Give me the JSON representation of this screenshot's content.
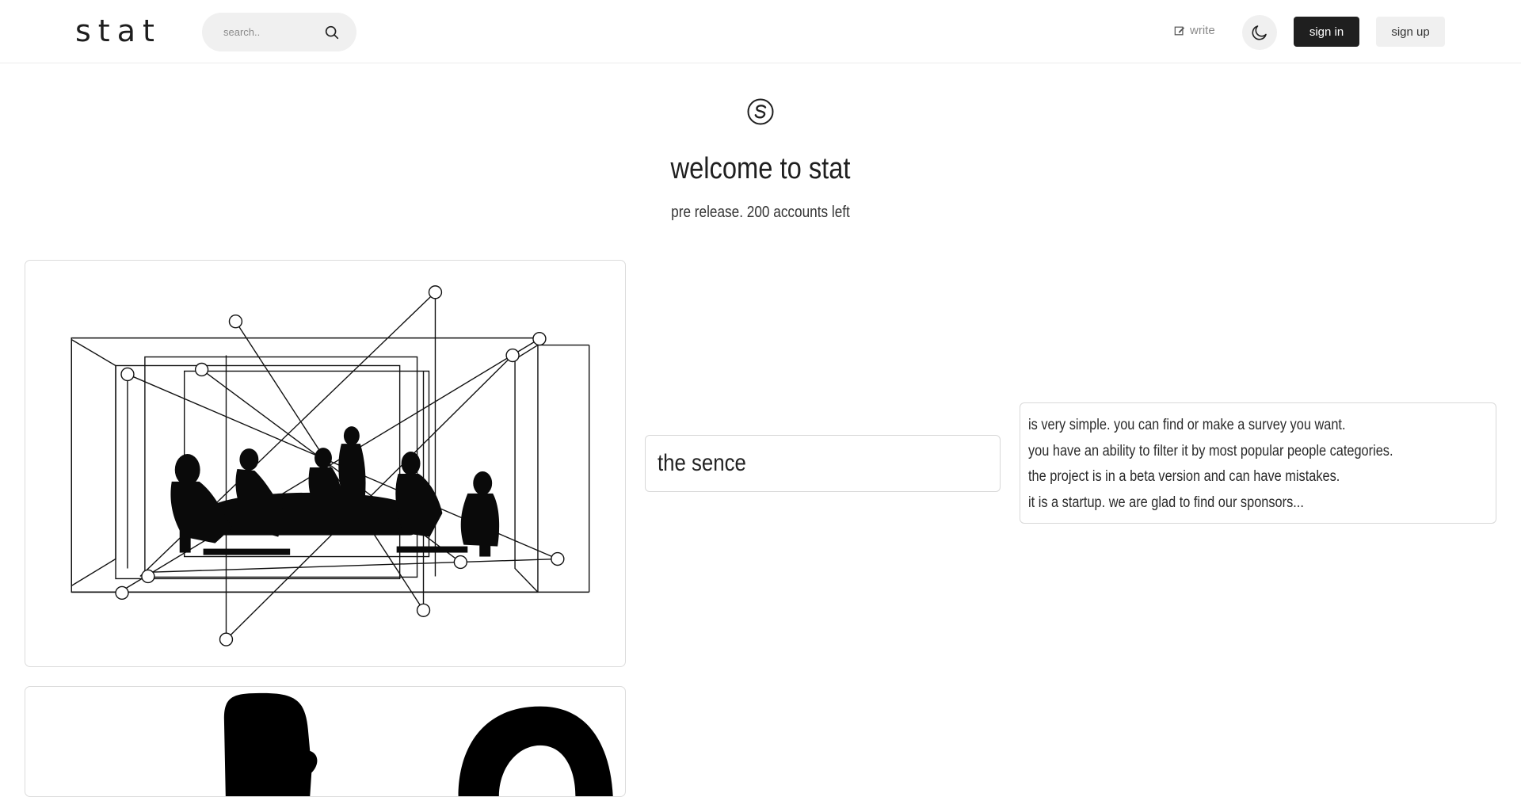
{
  "header": {
    "logo": "stat",
    "search": {
      "placeholder": "search..",
      "value": ""
    },
    "write_label": "write",
    "theme_toggle_icon": "moon-icon",
    "signin_label": "sign in",
    "signup_label": "sign up"
  },
  "hero": {
    "icon": "stat-s-logo-icon",
    "title": "welcome to stat",
    "subtitle": "pre release. 200 accounts left"
  },
  "sections": {
    "sence_title": "the sence",
    "description_lines": [
      "is very simple. you can find or make a survey you want.",
      "you have an ability to filter it by most popular people categories.",
      "the project is in a beta version and can have mistakes.",
      "it is a startup. we are glad to find our sponsors..."
    ]
  },
  "images": {
    "hero_card": "meeting-network-illustration",
    "second_card": "silhouette-illustration"
  },
  "colors": {
    "primary_dark": "#1f1f1f",
    "light_gray": "#f0f0f0",
    "border": "#dcdcdc",
    "muted_text": "#8a8a8a"
  }
}
